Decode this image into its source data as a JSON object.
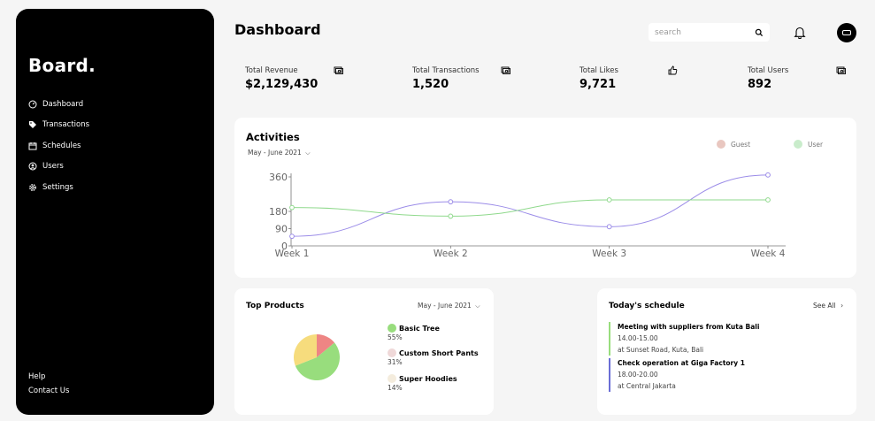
{
  "sidebar": {
    "brand": "Board.",
    "items": [
      {
        "label": "Dashboard",
        "icon": "gauge-icon"
      },
      {
        "label": "Transactions",
        "icon": "tag-icon"
      },
      {
        "label": "Schedules",
        "icon": "calendar-icon"
      },
      {
        "label": "Users",
        "icon": "user-icon"
      },
      {
        "label": "Settings",
        "icon": "gear-icon"
      }
    ],
    "footer": [
      "Help",
      "Contact Us"
    ]
  },
  "header": {
    "title": "Dashboard",
    "search_placeholder": "search"
  },
  "stats": [
    {
      "label": "Total Revenue",
      "value": "$2,129,430",
      "color": "#ddefe0"
    },
    {
      "label": "Total Transactions",
      "value": "1,520",
      "color": "#f4ecdd"
    },
    {
      "label": "Total Likes",
      "value": "9,721",
      "color": "#efdada"
    },
    {
      "label": "Total Users",
      "value": "892",
      "color": "#dee0ef"
    }
  ],
  "activities": {
    "title": "Activities",
    "range": "May - June 2021",
    "legend": [
      {
        "name": "Guest",
        "color": "#e9c7c0"
      },
      {
        "name": "User",
        "color": "#c9eccb"
      }
    ]
  },
  "chart_data": {
    "type": "line",
    "categories": [
      "Week 1",
      "Week 2",
      "Week 3",
      "Week 4"
    ],
    "yticks": [
      0,
      90,
      180,
      360
    ],
    "ylim": [
      0,
      360
    ],
    "series": [
      {
        "name": "Guest",
        "color": "#9b8ce8",
        "values": [
          50,
          230,
          100,
          370
        ]
      },
      {
        "name": "User",
        "color": "#8fd98c",
        "values": [
          200,
          155,
          240,
          240
        ]
      }
    ]
  },
  "top_products": {
    "title": "Top Products",
    "range": "May - June 2021",
    "items": [
      {
        "name": "Basic Tree",
        "percent": "55%",
        "value": 55,
        "color": "#98dd7d"
      },
      {
        "name": "Custom Short Pants",
        "percent": "31%",
        "value": 31,
        "color": "#f6dc7d"
      },
      {
        "name": "Super Hoodies",
        "percent": "14%",
        "value": 14,
        "color": "#ee8584"
      }
    ],
    "legend_colors": [
      "#98dd7d",
      "#efd8d8",
      "#f4ecdd"
    ]
  },
  "schedule": {
    "title": "Today's schedule",
    "see_all": "See All",
    "events": [
      {
        "title": "Meeting with suppliers from Kuta Bali",
        "time": "14.00-15.00",
        "location": "at Sunset Road, Kuta, Bali",
        "color": "#98dd7d"
      },
      {
        "title": "Check operation at Giga Factory 1",
        "time": "18.00-20.00",
        "location": "at Central Jakarta",
        "color": "#6b6ed6"
      }
    ]
  }
}
